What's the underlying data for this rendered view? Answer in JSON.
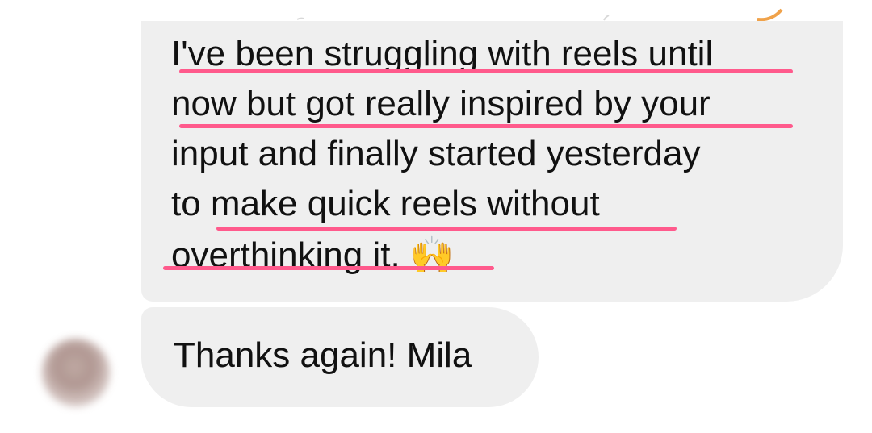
{
  "conversation": {
    "incoming_message": {
      "lines": [
        "I've been struggling with reels until",
        "now but got really inspired by your",
        "input and finally started yesterday",
        "to make quick reels without",
        "overthinking it. 🙌"
      ]
    },
    "followup_message": {
      "text": "Thanks again! Mila"
    },
    "sender_avatar": {
      "icon": "avatar-blurred-photo"
    }
  },
  "highlight": {
    "color": "#ff5a8c",
    "underlined_phrases": [
      "'ve been struggling with reels until",
      "now but got really inspired by your",
      "make quick reels without",
      "overthinking it."
    ]
  },
  "colors": {
    "bubble_background": "#efefef",
    "text": "#111111",
    "underline": "#ff5a8c"
  }
}
